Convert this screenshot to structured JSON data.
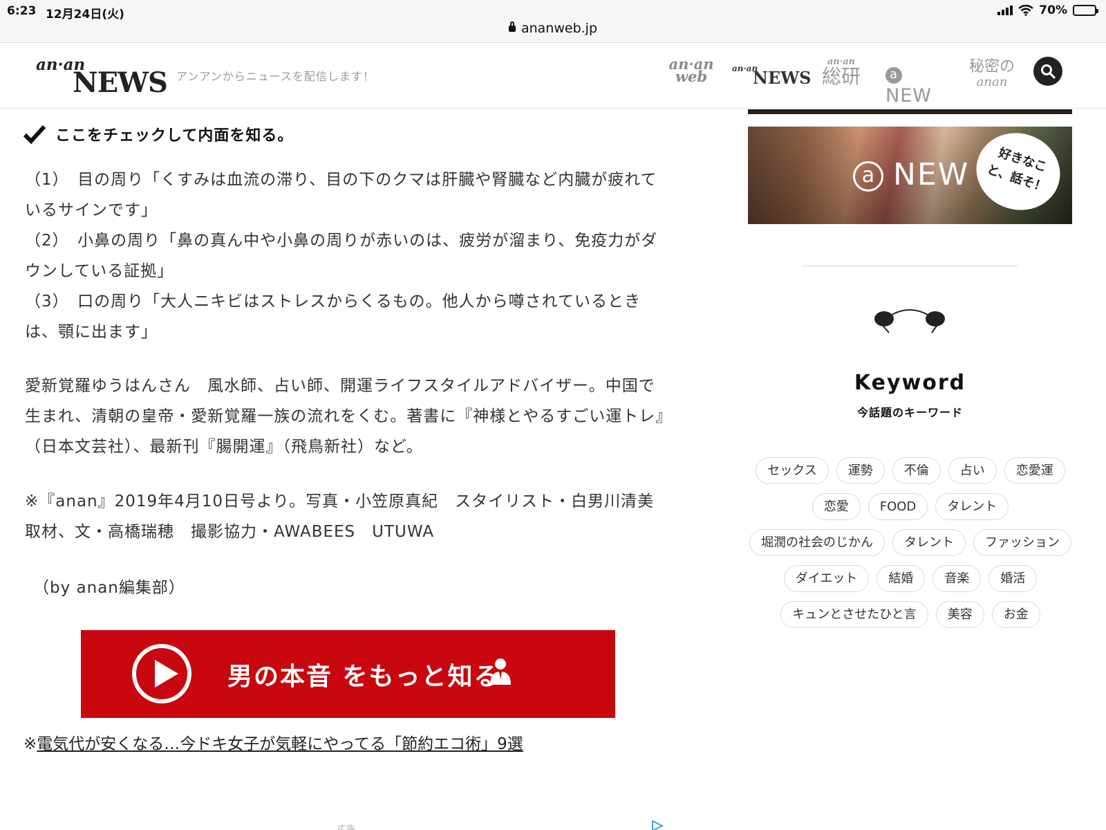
{
  "status_bar": {
    "time": "6:23",
    "date": "12月24日(火)",
    "battery": "70%",
    "battery_level": 0.7,
    "url": "ananweb.jp"
  },
  "header": {
    "logo_script": "an·an",
    "logo_news": "NEWS",
    "tagline": "アンアンからニュースを配信します！",
    "nav": {
      "anan_web": {
        "script": "an·an",
        "sub": "web"
      },
      "anan_news": {
        "script": "an·an",
        "sub": "NEWS"
      },
      "soken": {
        "script": "an·an",
        "sub": "総研"
      },
      "anew": {
        "mark": "a",
        "text": "NEW"
      },
      "himitsu": {
        "top": "秘密の",
        "sub": "anan"
      }
    },
    "icons": {
      "search": "search-icon"
    }
  },
  "article": {
    "check_heading": "ここをチェックして内面を知る。",
    "points_text": "（1）　目の周り「くすみは血流の滞り、目の下のクマは肝臓や腎臓など内臓が疲れているサインです」\n（2）　小鼻の周り「鼻の真ん中や小鼻の周りが赤いのは、疲労が溜まり、免疫力がダウンしている証拠」\n（3）　口の周り「大人ニキビはストレスからくるもの。他人から噂されているときは、顎に出ます」",
    "profile": "愛新覚羅ゆうはんさん　風水師、占い師、開運ライフスタイルアドバイザー。中国で生まれ、清朝の皇帝・愛新覚羅一族の流れをくむ。著書に『神様とやるすごい運トレ』（日本文芸社）、最新刊『腸開運』（飛鳥新社）など。",
    "credits": "※『anan』2019年4月10日号より。写真・小笠原真紀　スタイリスト・白男川清美　取材、文・高橋瑞穂　撮影協力・AWABEES　UTUWA",
    "byline": "（by anan編集部）",
    "banner_text": "男の本音 をもっと知る",
    "banner_color": "#c8070f",
    "related_prefix": "※",
    "related_link": "電気代が安くなる…今ドキ女子が気軽にやってる「節約エコ術」9選",
    "ad_label": "広告"
  },
  "sidebar": {
    "anew_banner": {
      "mark": "a",
      "text": "NEW",
      "bubble": "好きなこと、話そ！"
    },
    "keyword_title": "Keyword",
    "keyword_subtitle": "今話題のキーワード",
    "tags": [
      "セックス",
      "運勢",
      "不倫",
      "占い",
      "恋愛運",
      "恋愛",
      "FOOD",
      "タレント",
      "堀潤の社会のじかん",
      "タレント",
      "ファッション",
      "ダイエット",
      "結婚",
      "音楽",
      "婚活",
      "キュンとさせたひと言",
      "美容",
      "お金"
    ]
  }
}
